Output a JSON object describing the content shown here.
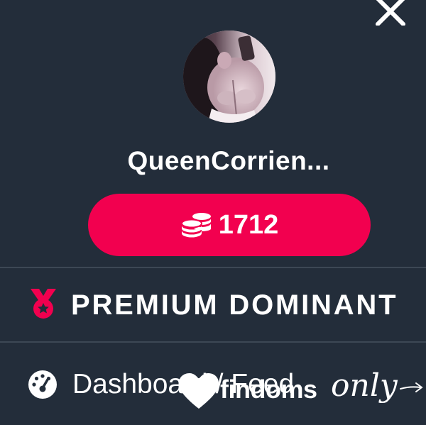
{
  "profile": {
    "username": "QueenCorrien...",
    "coins": "1712",
    "avatar_icon": "profile-photo"
  },
  "menu": {
    "premium_label": "PREMIUM DOMINANT",
    "dashboard_label": "Dashboard / Feed"
  },
  "watermark": {
    "brand": "findoms",
    "script": "only"
  },
  "icons": {
    "close": "close-icon",
    "coins": "coins-icon",
    "medal": "medal-icon",
    "dashboard": "gauge-icon"
  },
  "colors": {
    "background": "#232d3a",
    "accent": "#f2004f",
    "divider": "#3d4855",
    "text": "#ffffff"
  }
}
